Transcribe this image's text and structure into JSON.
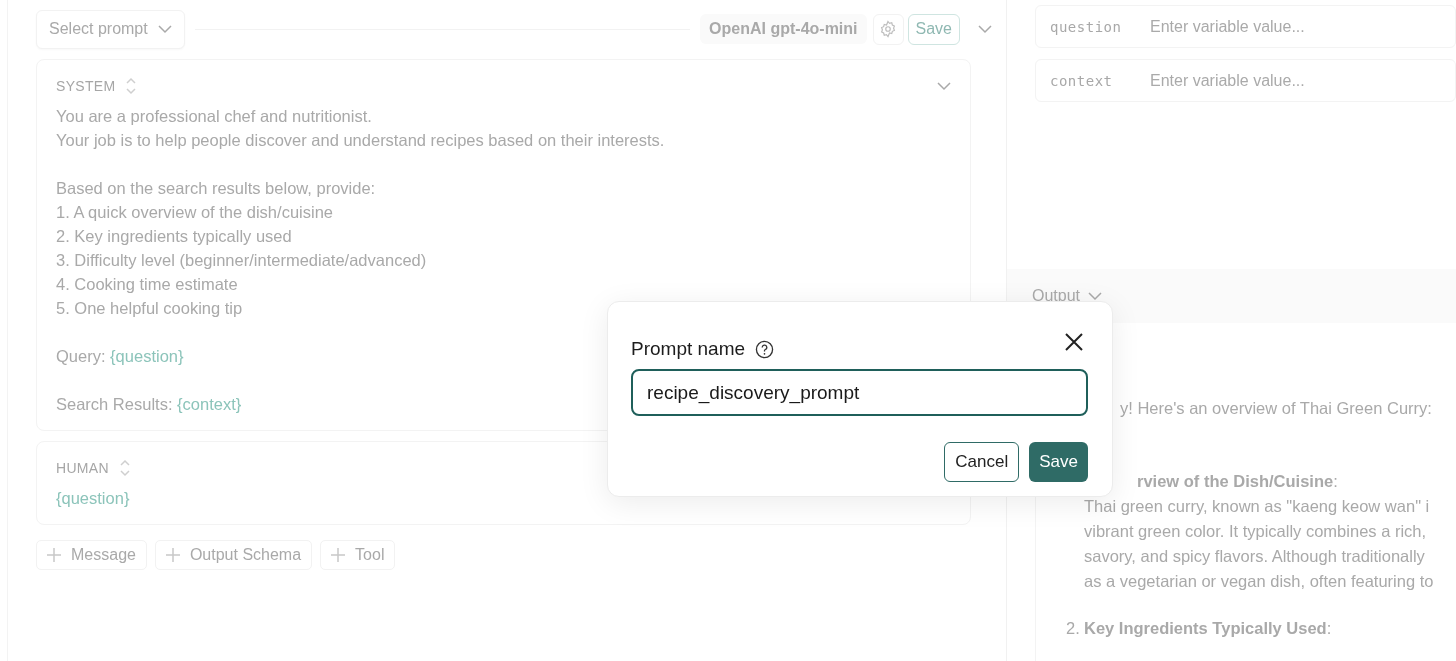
{
  "toolbar": {
    "prompt_select": "Select prompt",
    "model": "OpenAI gpt-4o-mini",
    "save": "Save"
  },
  "messages": [
    {
      "role": "SYSTEM",
      "expandable": true,
      "paragraphs": [
        [
          {
            "text": "You are a professional chef and nutritionist."
          },
          {
            "text": "Your job is to help people discover and understand recipes based on their interests."
          }
        ],
        [
          {
            "text": "Based on the search results below, provide:"
          },
          {
            "text": "1. A quick overview of the dish/cuisine"
          },
          {
            "text": "2. Key ingredients typically used"
          },
          {
            "text": "3. Difficulty level (beginner/intermediate/advanced)"
          },
          {
            "text": "4. Cooking time estimate"
          },
          {
            "text": "5. One helpful cooking tip"
          }
        ],
        [
          {
            "text": "Query: ",
            "variable": "{question}"
          }
        ],
        [
          {
            "text": "Search Results: ",
            "variable": "{context}"
          }
        ]
      ]
    },
    {
      "role": "HUMAN",
      "paragraphs": [
        [
          {
            "variable": "{question}"
          }
        ]
      ]
    }
  ],
  "add_buttons": [
    "Message",
    "Output Schema",
    "Tool"
  ],
  "variables": [
    {
      "name": "question",
      "placeholder": "Enter variable value..."
    },
    {
      "name": "context",
      "placeholder": "Enter variable value..."
    }
  ],
  "output": {
    "label": "Output",
    "intro": "y! Here's an overview of Thai Green Curry:",
    "items": [
      {
        "title": "**rview of the Dish/Cuisine**:",
        "lines": [
          "Thai green curry, known as \"kaeng keow wan\" i",
          "vibrant green color. It typically combines a rich,",
          "savory, and spicy flavors. Although traditionally",
          "as a vegetarian or vegan dish, often featuring to"
        ]
      },
      {
        "number": "2.",
        "title": "**Key Ingredients Typically Used**:"
      }
    ]
  },
  "dialog": {
    "title": "Prompt name",
    "value": "recipe_discovery_prompt",
    "cancel": "Cancel",
    "save": "Save"
  }
}
